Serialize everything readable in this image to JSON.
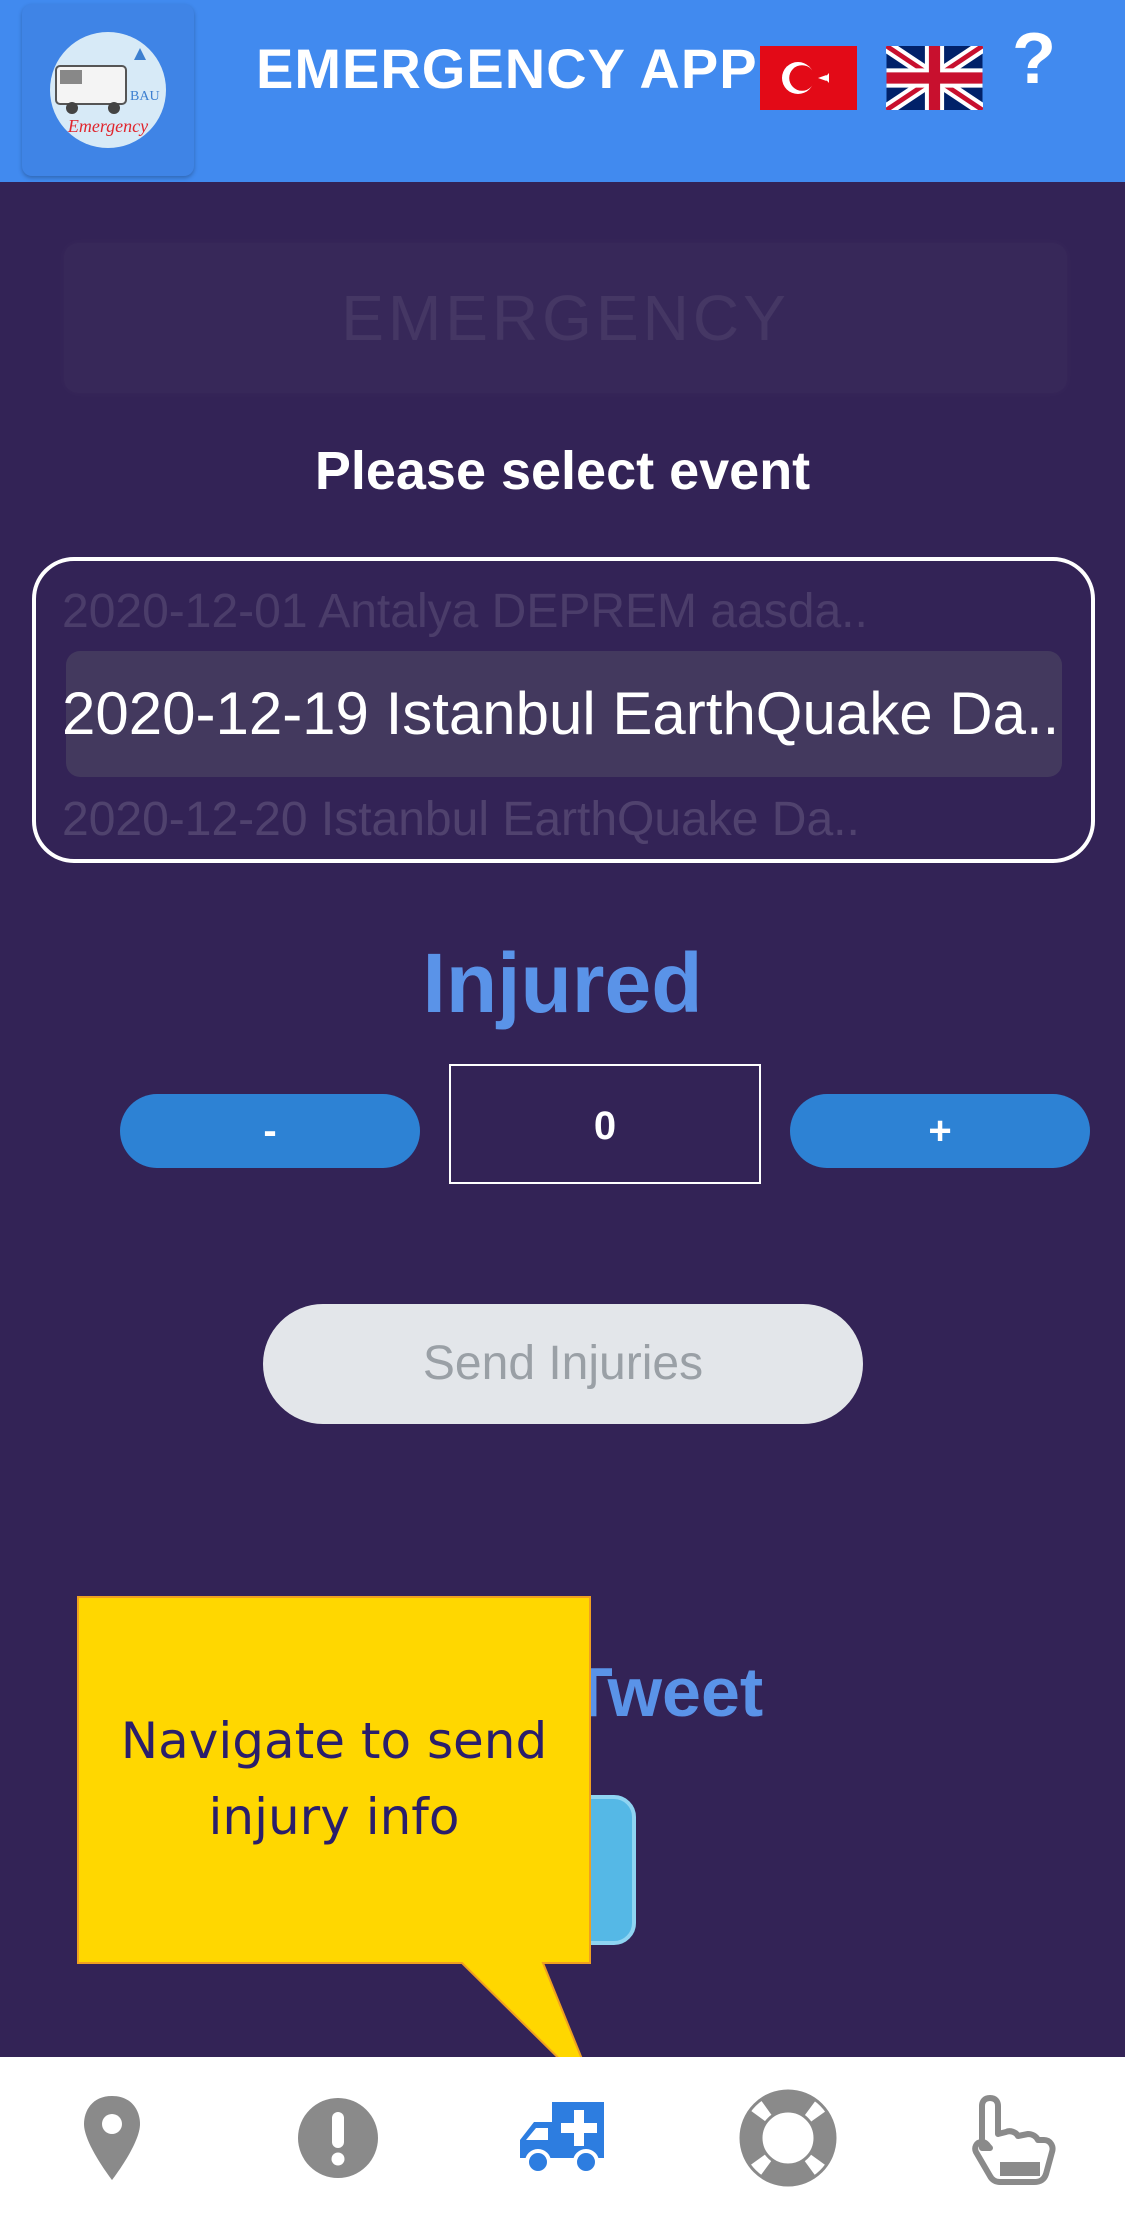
{
  "header": {
    "logo_text": "Emergency",
    "logo_sub": "BAU",
    "title": "EMERGENCY APP",
    "help_label": "?",
    "languages": [
      "turkish-flag",
      "english-flag"
    ]
  },
  "main": {
    "ghost_heading": "EMERGENCY",
    "select_prompt": "Please select event",
    "events": {
      "previous": "2020-12-01 Antalya DEPREM aasda..",
      "selected": "2020-12-19 Istanbul EarthQuake Da..",
      "next": "2020-12-20 Istanbul EarthQuake Da.."
    },
    "injured": {
      "title": "Injured",
      "decrement_label": "-",
      "increment_label": "+",
      "count": "0"
    },
    "send_label": "Send Injuries",
    "tweet_title": "Tweet"
  },
  "tooltip": {
    "text": "Navigate to send injury info",
    "fill": "#ffd700"
  },
  "bottom_nav": {
    "items": [
      {
        "icon": "map-pin-icon",
        "active": false
      },
      {
        "icon": "alert-icon",
        "active": false
      },
      {
        "icon": "ambulance-icon",
        "active": true
      },
      {
        "icon": "lifebuoy-icon",
        "active": false
      },
      {
        "icon": "touch-icon",
        "active": false
      }
    ]
  },
  "colors": {
    "header": "#418aef",
    "background": "#332356",
    "accent": "#5a93e8",
    "button": "#2d82d4",
    "nav_active": "#2d7de0",
    "nav_inactive": "#8a8a8a"
  }
}
